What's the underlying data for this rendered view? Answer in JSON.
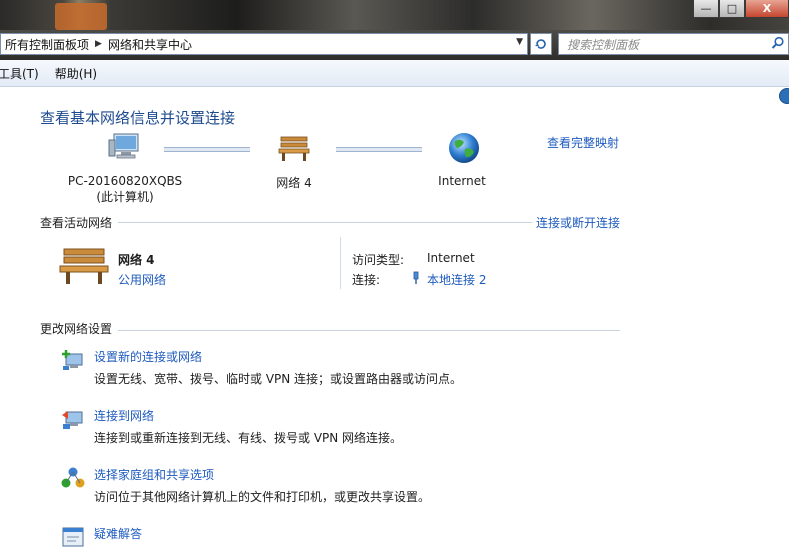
{
  "window": {
    "btn_minimize": "—",
    "btn_maximize": "□",
    "btn_close": "X"
  },
  "address": {
    "crumbs": [
      "所有控制面板项",
      "网络和共享中心"
    ],
    "search_placeholder": "搜索控制面板"
  },
  "menu": [
    "工具(T)",
    "帮助(H)"
  ],
  "page": {
    "title": "查看基本网络信息并设置连接",
    "full_map_link": "查看完整映射"
  },
  "map": {
    "computer_name": "PC-20160820XQBS",
    "computer_sub": "(此计算机)",
    "network_name": "网络  4",
    "internet_label": "Internet"
  },
  "active_networks": {
    "heading": "查看活动网络",
    "connect_link": "连接或断开连接",
    "network_name": "网络  4",
    "network_type": "公用网络",
    "access_type_label": "访问类型:",
    "access_type_value": "Internet",
    "connections_label": "连接:",
    "connections_value": "本地连接 2"
  },
  "change_settings": {
    "heading": "更改网络设置",
    "tasks": [
      {
        "title": "设置新的连接或网络",
        "desc": "设置无线、宽带、拨号、临时或 VPN 连接；或设置路由器或访问点。"
      },
      {
        "title": "连接到网络",
        "desc": "连接到或重新连接到无线、有线、拨号或 VPN 网络连接。"
      },
      {
        "title": "选择家庭组和共享选项",
        "desc": "访问位于其他网络计算机上的文件和打印机，或更改共享设置。"
      },
      {
        "title": "疑难解答",
        "desc": ""
      }
    ]
  },
  "colors": {
    "link": "#1e5bbf",
    "title": "#1e4b8f"
  }
}
